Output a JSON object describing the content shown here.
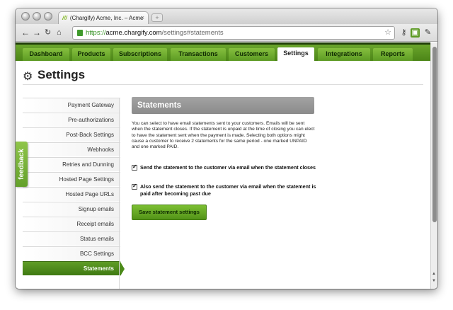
{
  "browser": {
    "tab_title": "(Chargify) Acme, Inc. – Acme",
    "tab_favicon": "///",
    "url_scheme": "https://",
    "url_host": "acme.chargify.com",
    "url_path": "/settings#statements"
  },
  "nav": {
    "tabs": [
      "Dashboard",
      "Products",
      "Subscriptions",
      "Transactions",
      "Customers",
      "Settings",
      "Integrations",
      "Reports"
    ],
    "active": "Settings"
  },
  "page": {
    "title": "Settings"
  },
  "sidebar": {
    "items": [
      "Payment Gateway",
      "Pre-authorizations",
      "Post-Back Settings",
      "Webhooks",
      "Retries and Dunning",
      "Hosted Page Settings",
      "Hosted Page URLs",
      "Signup emails",
      "Receipt emails",
      "Status emails",
      "BCC Settings",
      "Statements"
    ],
    "active": "Statements"
  },
  "feedback": {
    "label": "feedback"
  },
  "main": {
    "heading": "Statements",
    "description": "You can select to have email statements sent to your customers. Emails will be sent when the statement closes. If the statement is unpaid at the time of closing you can elect to have the statement sent when the payment is made. Selecting both options might cause a customer to receive 2 statements for the same period - one marked UNPAID and one marked PAID.",
    "checkbox_close": {
      "label": "Send the statement to the customer via email when the statement closes",
      "checked": true
    },
    "checkbox_paid": {
      "label": "Also send the statement to the customer via email when the statement is paid after becoming past due",
      "checked": true
    },
    "save_button": "Save statement settings"
  },
  "colors": {
    "brand_green": "#5c9a23",
    "nav_dark": "#1f3d08",
    "panel_gray": "#999999"
  }
}
